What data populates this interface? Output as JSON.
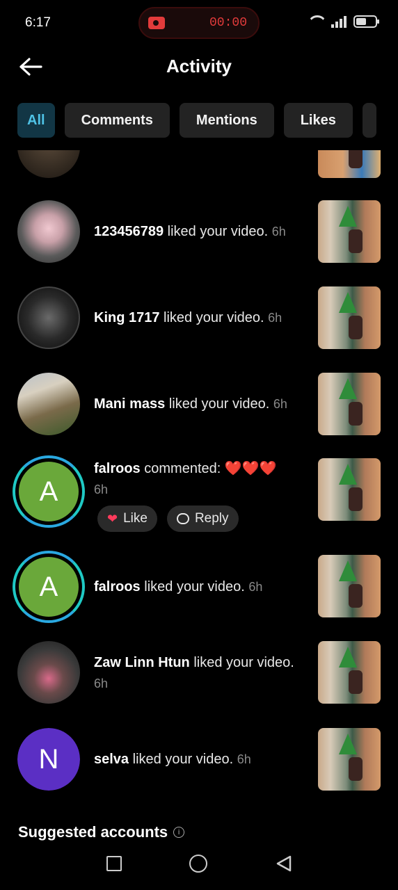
{
  "status": {
    "time": "6:17",
    "recording_time": "00:00"
  },
  "header": {
    "title": "Activity"
  },
  "filters": [
    "All",
    "Comments",
    "Mentions",
    "Likes"
  ],
  "notifications": [
    {
      "user": "123456789",
      "action": "liked your video.",
      "time": "6h"
    },
    {
      "user": "King 1717",
      "action": "liked your video.",
      "time": "6h"
    },
    {
      "user": "Mani mass",
      "action": "liked your video.",
      "time": "6h"
    },
    {
      "user": "falroos",
      "action": "commented: ❤️❤️❤️",
      "time": "6h",
      "avatar_letter": "A",
      "like_label": "Like",
      "reply_label": "Reply"
    },
    {
      "user": "falroos",
      "action": "liked your video.",
      "time": "6h",
      "avatar_letter": "A"
    },
    {
      "user": "Zaw Linn Htun",
      "action": "liked your video.",
      "time": "6h"
    },
    {
      "user": "selva",
      "action": "liked your video.",
      "time": "6h",
      "avatar_letter": "N"
    }
  ],
  "suggested": {
    "title": "Suggested accounts",
    "info_icon": "i"
  },
  "colors": {
    "active_chip_bg": "#123645",
    "active_chip_text": "#4fc3e6",
    "avatar_green": "#6aa83a",
    "avatar_purple": "#5b2fc4",
    "heart": "#ff3b5c"
  }
}
